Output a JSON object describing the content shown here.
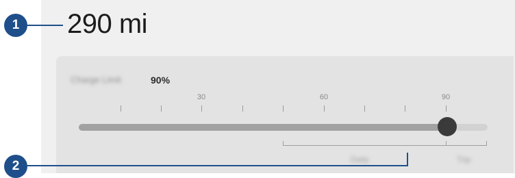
{
  "header": {
    "range": "290 mi"
  },
  "callouts": [
    "1",
    "2"
  ],
  "charge": {
    "limit_label": "Charge Limit",
    "limit_value": "90%",
    "slider_fraction": 0.9
  },
  "scale": {
    "tick_labels": [
      "30",
      "60",
      "90"
    ]
  },
  "bracket_labels": {
    "daily": "Daily",
    "trip": "Trip"
  },
  "colors": {
    "callout": "#1e4f8a",
    "thumb": "#3a3a3a",
    "track": "#d2d2d2",
    "track_fill": "#a1a1a1"
  }
}
